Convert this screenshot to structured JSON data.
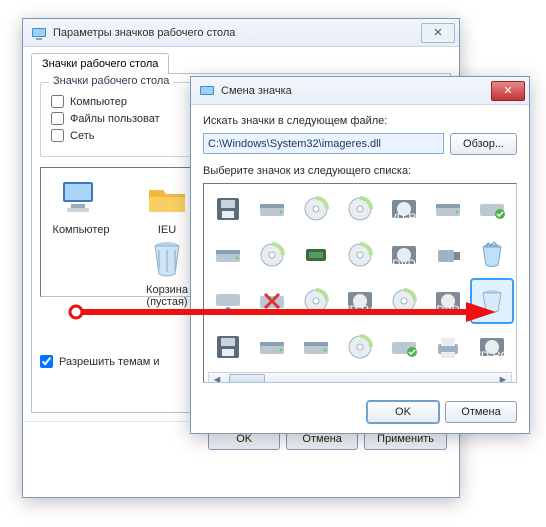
{
  "parent": {
    "title": "Параметры значков рабочего стола",
    "tab": "Значки рабочего стола",
    "group_title": "Значки рабочего стола",
    "chk_computer": "Компьютер",
    "chk_userfiles": "Файлы пользоват",
    "chk_network": "Сеть",
    "icon_computer": "Компьютер",
    "icon_ieuser": "IEU",
    "icon_bin_line1": "Корзина",
    "icon_bin_line2": "(пустая)",
    "chk_themes": "Разрешить темам и",
    "ok": "OK",
    "cancel": "Отмена",
    "apply": "Применить"
  },
  "change": {
    "title": "Смена значка",
    "label_path": "Искать значки в следующем файле:",
    "path_value": "C:\\Windows\\System32\\imageres.dll",
    "browse": "Обзор...",
    "label_pick": "Выберите значок из следующего списка:",
    "ok": "OK",
    "cancel": "Отмена"
  }
}
